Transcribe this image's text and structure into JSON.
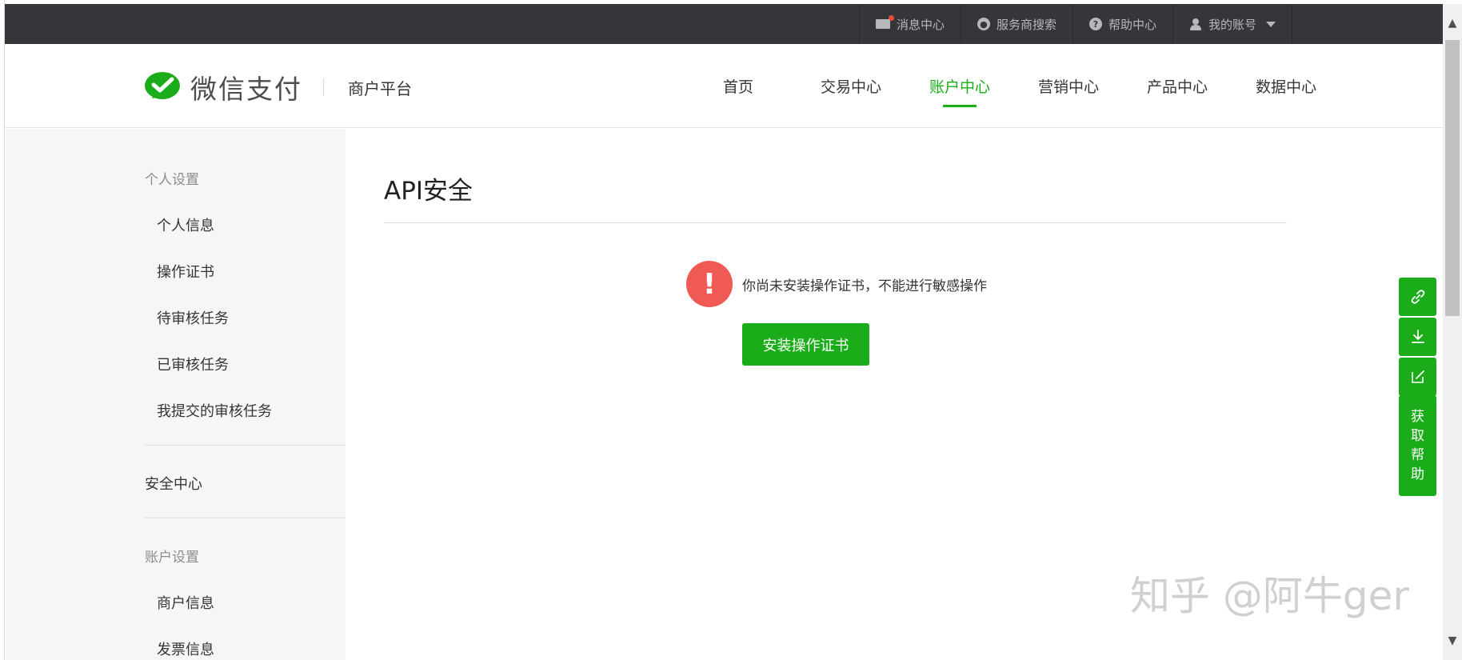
{
  "topbar": {
    "messages": "消息中心",
    "provider_search": "服务商搜索",
    "help": "帮助中心",
    "account": "我的账号"
  },
  "header": {
    "logo_text": "微信支付",
    "subtitle": "商户平台",
    "nav": [
      "首页",
      "交易中心",
      "账户中心",
      "营销中心",
      "产品中心",
      "数据中心"
    ],
    "active_nav": "账户中心"
  },
  "sidebar": {
    "group_personal": "个人设置",
    "personal_items": [
      "个人信息",
      "操作证书",
      "待审核任务",
      "已审核任务",
      "我提交的审核任务"
    ],
    "security_center": "安全中心",
    "group_account": "账户设置",
    "account_items": [
      "商户信息",
      "发票信息"
    ]
  },
  "main": {
    "title": "API安全",
    "alert_icon": "!",
    "alert_text": "你尚未安装操作证书，不能进行敏感操作",
    "install_button": "安装操作证书"
  },
  "float_toolbar": {
    "help_chars": [
      "获",
      "取",
      "帮",
      "助"
    ]
  },
  "watermark": "知乎 @阿牛ger",
  "colors": {
    "brand_green": "#1aad19",
    "topbar_bg": "#353639",
    "alert_red": "#f05a55"
  }
}
